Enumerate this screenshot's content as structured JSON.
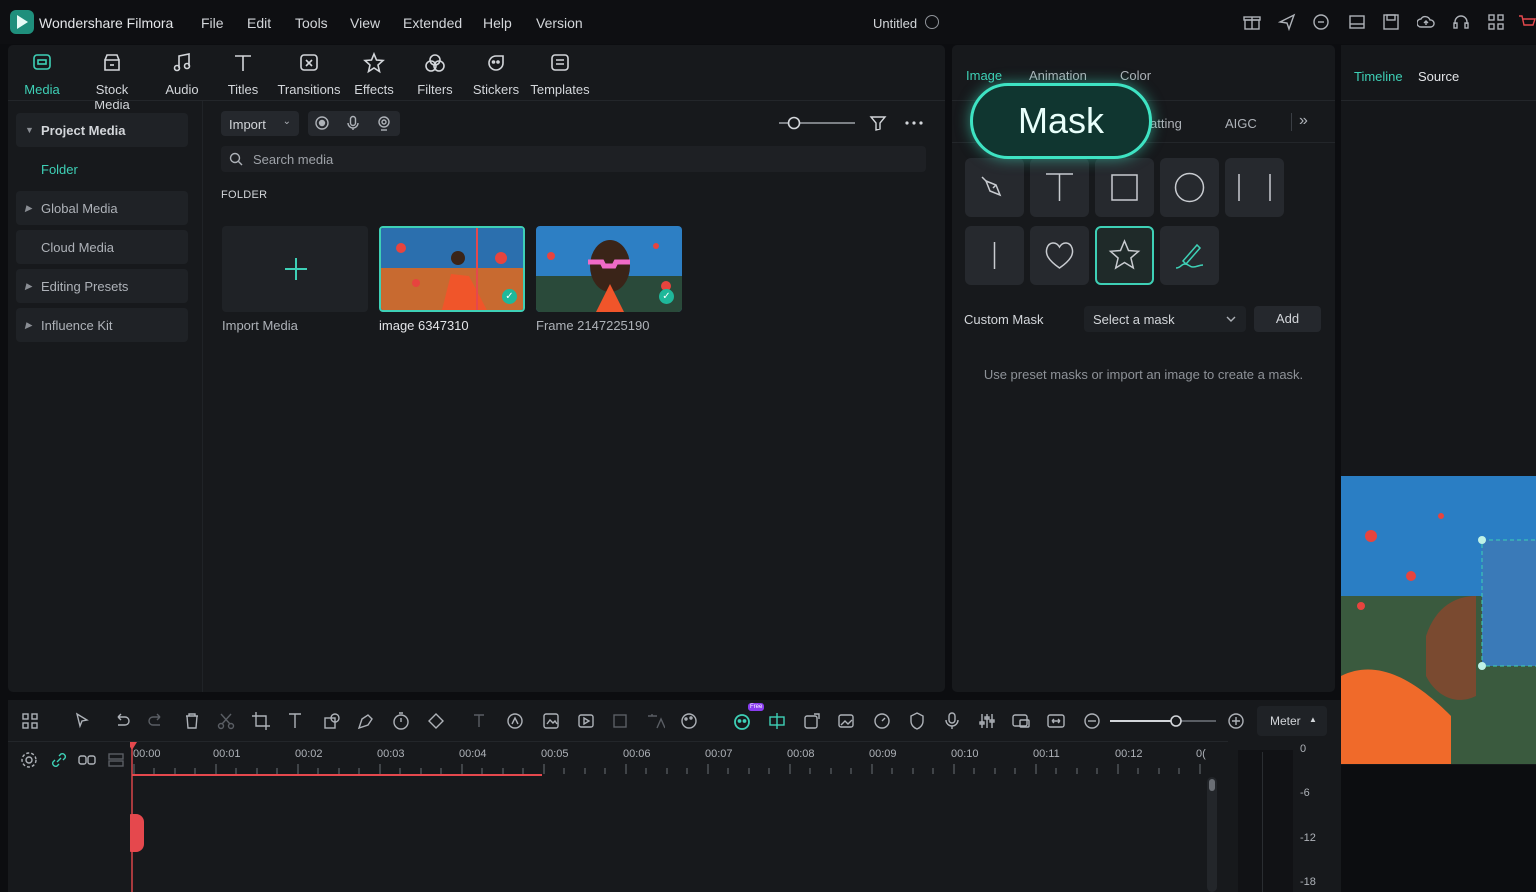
{
  "app": {
    "name": "Wondershare Filmora",
    "doc_title": "Untitled"
  },
  "menu": [
    "File",
    "Edit",
    "Tools",
    "View",
    "Extended",
    "Help",
    "Version"
  ],
  "toolbar": [
    "Media",
    "Stock Media",
    "Audio",
    "Titles",
    "Transitions",
    "Effects",
    "Filters",
    "Stickers",
    "Templates"
  ],
  "sidebar": {
    "project_media": "Project Media",
    "folder": "Folder",
    "global_media": "Global Media",
    "cloud_media": "Cloud Media",
    "editing_presets": "Editing Presets",
    "influence_kit": "Influence Kit"
  },
  "media": {
    "import_label": "Import",
    "search_placeholder": "Search media",
    "folder_heading": "FOLDER",
    "items": [
      "Import Media",
      "image 6347310",
      "Frame 2147225190"
    ]
  },
  "properties": {
    "tabs": [
      "Image",
      "Animation",
      "Color"
    ],
    "subtab_partial": "atting",
    "subtab_aigc": "AIGC",
    "mask_callout": "Mask",
    "custom_mask_label": "Custom Mask",
    "select_placeholder": "Select a mask",
    "add_label": "Add",
    "hint": "Use preset masks or import an image to create a mask."
  },
  "player": {
    "tab_timeline": "Timeline",
    "tab_source": "Source"
  },
  "timeline": {
    "meter_label": "Meter",
    "new_badge": "Free",
    "ruler": [
      "00:00",
      "00:01",
      "00:02",
      "00:03",
      "00:04",
      "00:05",
      "00:06",
      "00:07",
      "00:08",
      "00:09",
      "00:10",
      "00:11",
      "00:12",
      "0("
    ],
    "db_scale": [
      "0",
      "-6",
      "-12",
      "-18"
    ]
  },
  "colors": {
    "accent": "#3ed0b6",
    "playhead": "#e5484d",
    "bg": "#17191c"
  }
}
